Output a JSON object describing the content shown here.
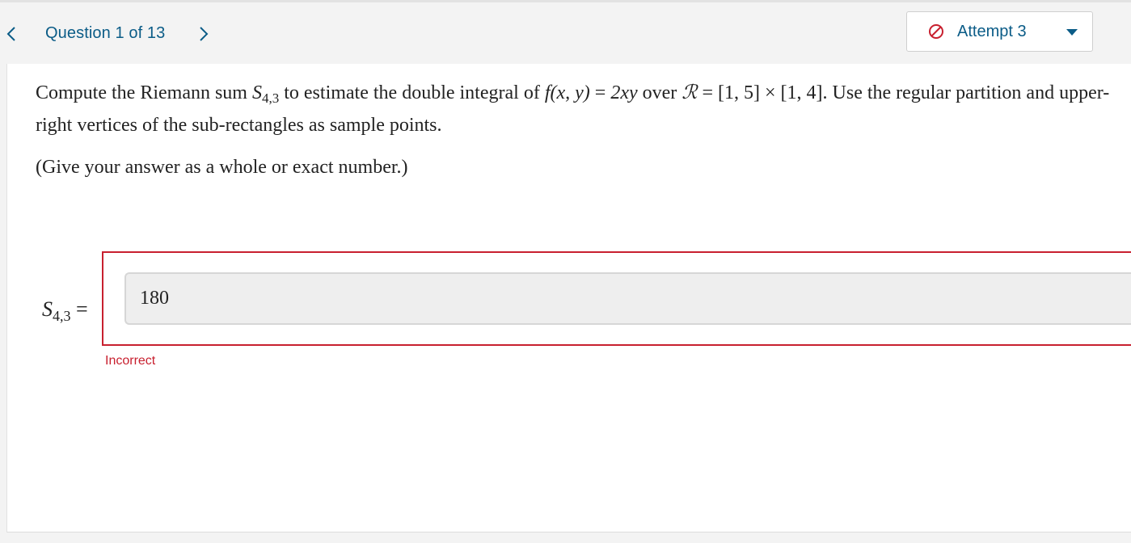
{
  "nav": {
    "prev_icon": "chevron-left-icon",
    "next_icon": "chevron-right-icon",
    "question_counter": "Question 1 of 13"
  },
  "attempt": {
    "icon": "no-entry-icon",
    "label": "Attempt 3",
    "caret_icon": "caret-down-icon"
  },
  "question": {
    "part1": "Compute the Riemann sum ",
    "sum_symbol": "S",
    "sum_subscript": "4,3",
    "part2": " to estimate the double integral of ",
    "func_name": "f",
    "func_args": "(x, y)",
    "equals": " = ",
    "func_expr": "2xy",
    "part3": " over ",
    "region_symbol": "𝓛",
    "region_equals": " = ",
    "region_value": "[1, 5] × [1, 4]",
    "part4": ". Use the regular partition and upper-right vertices of the sub-rectangles as sample points.",
    "hint": "(Give your answer as a whole or exact number.)"
  },
  "answer": {
    "label_symbol": "S",
    "label_subscript": "4,3",
    "label_equals": " =",
    "value": "180",
    "feedback": "Incorrect"
  },
  "colors": {
    "link": "#0b5c87",
    "error": "#c8202f",
    "background": "#f3f3f3",
    "card": "#ffffff",
    "input_bg": "#eeeeee"
  }
}
